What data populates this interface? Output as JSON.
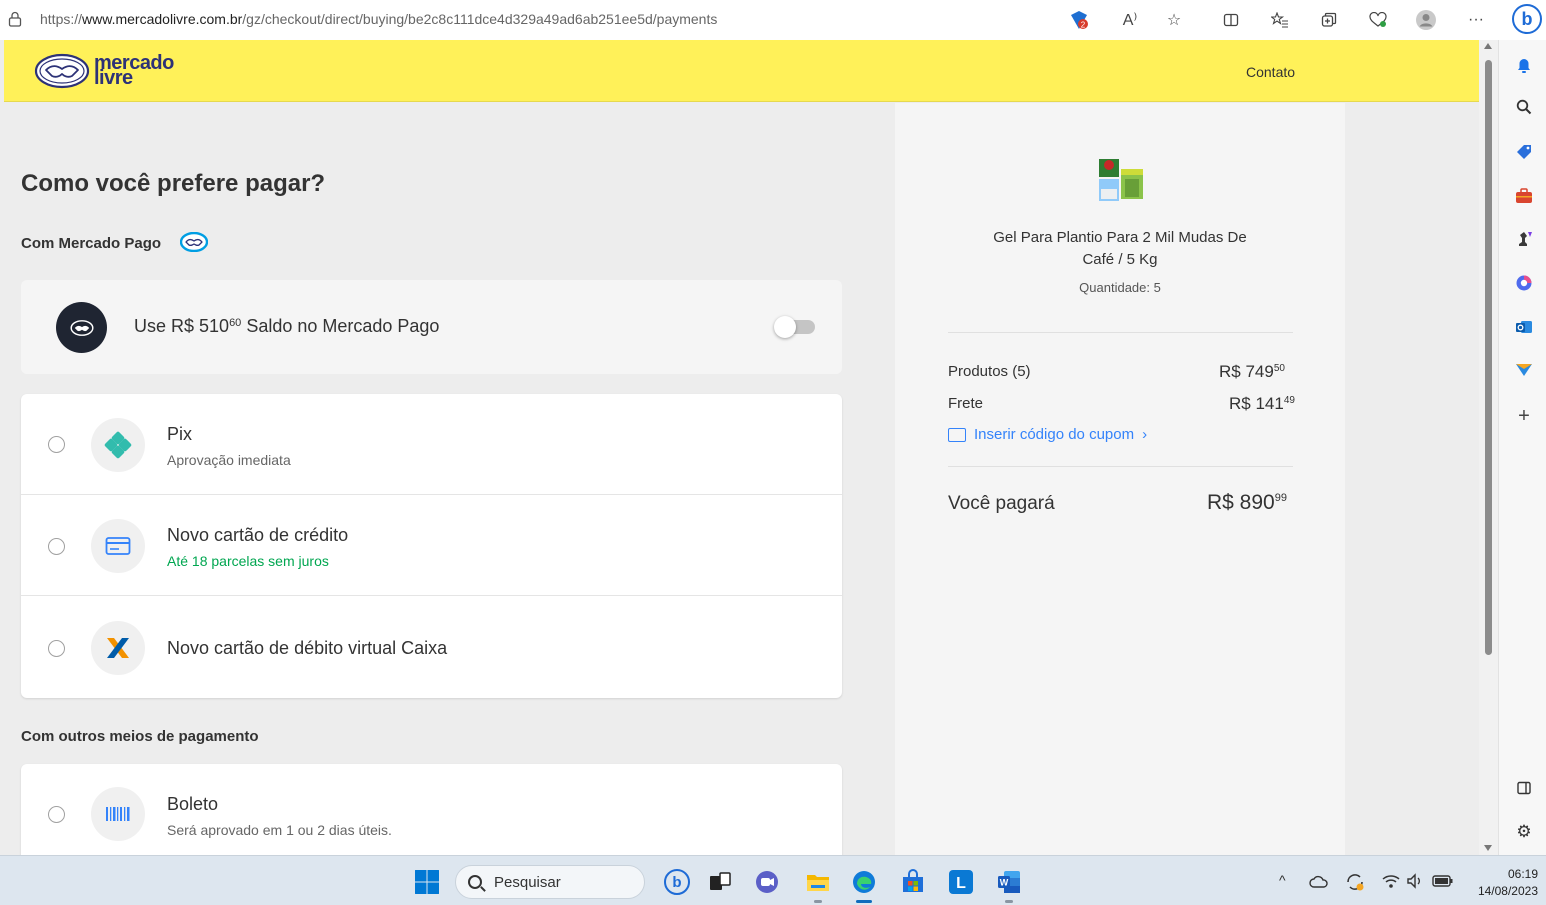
{
  "browser": {
    "url_prefix": "https://",
    "url_domain": "www.mercadolivre.com.br",
    "url_path": "/gz/checkout/direct/buying/be2c8c111dce4d329a49ad6ab251ee5d/payments",
    "read_aloud": "A⁾",
    "badge_count": "2"
  },
  "header": {
    "logo_line1": "mercado",
    "logo_line2": "livre",
    "contact_link": "Contato"
  },
  "payment": {
    "page_title": "Como você prefere pagar?",
    "mercado_pago_section": "Com Mercado Pago",
    "balance": {
      "prefix": "Use R$ 510",
      "cents": "60",
      "suffix": " Saldo no Mercado Pago"
    },
    "options": [
      {
        "title": "Pix",
        "subtitle": "Aprovação imediata"
      },
      {
        "title": "Novo cartão de crédito",
        "subtitle": "Até 18 parcelas sem juros"
      },
      {
        "title": "Novo cartão de débito virtual Caixa",
        "subtitle": ""
      }
    ],
    "other_section": "Com outros meios de pagamento",
    "boleto": {
      "title": "Boleto",
      "subtitle": "Será aprovado em 1 ou 2 dias úteis."
    }
  },
  "summary": {
    "product_name": "Gel Para Plantio Para 2 Mil Mudas De Café / 5 Kg",
    "quantity": "Quantidade: 5",
    "products_label": "Produtos (5)",
    "products_value": "R$ 749",
    "products_cents": "50",
    "shipping_label": "Frete",
    "shipping_value": "R$ 141",
    "shipping_cents": "49",
    "coupon_link": "Inserir código do cupom",
    "total_label": "Você pagará",
    "total_value": "R$ 890",
    "total_cents": "99"
  },
  "taskbar": {
    "search_placeholder": "Pesquisar",
    "time": "06:19",
    "date": "14/08/2023"
  },
  "colors": {
    "header_yellow": "#fff159",
    "link_blue": "#3483fa",
    "success_green": "#00a650",
    "pix_teal": "#32bcad"
  }
}
